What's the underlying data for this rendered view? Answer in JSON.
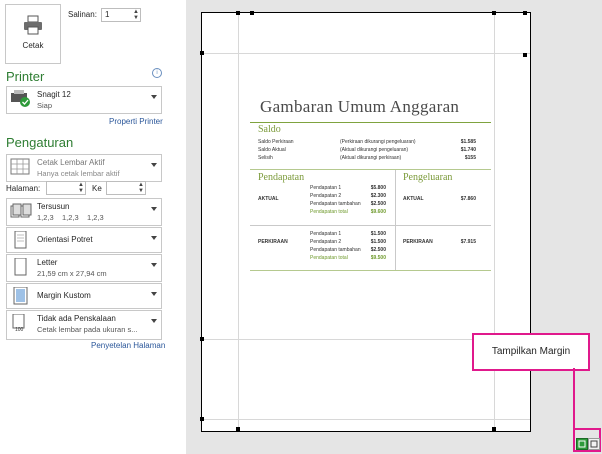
{
  "print": {
    "label": "Cetak",
    "copies_label": "Salinan:",
    "copies_value": "1"
  },
  "printer": {
    "heading": "Printer",
    "name": "Snagit 12",
    "status": "Siap",
    "properties_link": "Properti Printer"
  },
  "settings": {
    "heading": "Pengaturan",
    "scope_line1": "Cetak Lembar Aktif",
    "scope_line2": "Hanya cetak lembar aktif",
    "pages_label": "Halaman:",
    "to_label": "Ke",
    "collate_title": "Tersusun",
    "collate_sub": "1,2,3    1,2,3    1,2,3",
    "orientation": "Orientasi Potret",
    "paper_title": "Letter",
    "paper_sub": "21,59 cm x 27,94 cm",
    "margins": "Margin Kustom",
    "scaling_title": "Tidak ada Penskalaan",
    "scaling_sub": "Cetak lembar pada ukuran s...",
    "page_setup_link": "Penyetelan Halaman"
  },
  "preview": {
    "title": "Gambaran Umum Anggaran",
    "saldo": {
      "heading": "Saldo",
      "rows": [
        {
          "label": "Saldo Perkiraan",
          "note": "(Perkiraan dikurangi pengeluaran)",
          "value": "$1.585"
        },
        {
          "label": "Saldo Aktual",
          "note": "(Aktual dikurangi pengeluaran)",
          "value": "$1.740"
        },
        {
          "label": "Selisih",
          "note": "(Aktual dikurangi perkiraan)",
          "value": "$155"
        }
      ]
    },
    "pendapatan": {
      "heading": "Pendapatan",
      "actual": {
        "label": "AKTUAL",
        "items": [
          {
            "label": "Pendapatan 1",
            "value": "$5.800"
          },
          {
            "label": "Pendapatan 2",
            "value": "$2.300"
          },
          {
            "label": "Pendapatan tambahan",
            "value": "$2.500"
          }
        ],
        "total_label": "Pendapatan total",
        "total_value": "$9.600"
      },
      "estimate": {
        "label": "PERKIRAAN",
        "items": [
          {
            "label": "Pendapatan 1",
            "value": "$1.500"
          },
          {
            "label": "Pendapatan 2",
            "value": "$1.500"
          },
          {
            "label": "Pendapatan tambahan",
            "value": "$2.500"
          }
        ],
        "total_label": "Pendapatan total",
        "total_value": "$9.500"
      }
    },
    "pengeluaran": {
      "heading": "Pengeluaran",
      "actual_label": "AKTUAL",
      "actual_value": "$7.860",
      "estimate_label": "PERKIRAAN",
      "estimate_value": "$7.915"
    }
  },
  "callout": {
    "text": "Tampilkan Margin"
  },
  "colors": {
    "accent_green": "#2e7d32",
    "link_blue": "#2b579a",
    "callout": "#e0198c"
  }
}
